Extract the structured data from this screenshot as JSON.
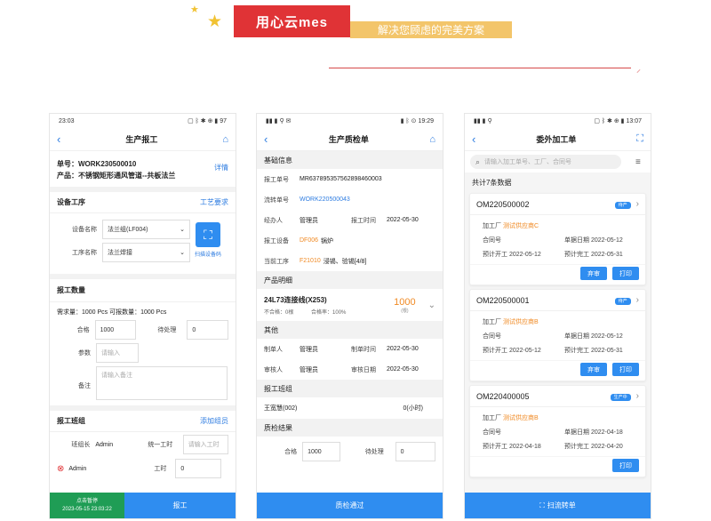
{
  "header": {
    "brand": "用心云mes",
    "tagline": "解决您顾虑的完美方案"
  },
  "phone1": {
    "time": "23:03",
    "status_icons": "▢ ᛒ ✱ ⊕ ▮ 97",
    "title": "生产报工",
    "order_label": "单号：",
    "order_no": "WORK230500010",
    "product_label": "产品：",
    "product": "不锈钢矩形通风管道--共板法兰",
    "detail_link": "详情",
    "equip_section": "设备工序",
    "process_req": "工艺要求",
    "equip_name_label": "设备名称",
    "equip_name_value": "法兰组(LF004)",
    "process_name_label": "工序名称",
    "process_name_value": "法兰焊接",
    "scan_label": "扫描设备码",
    "qty_section": "报工数量",
    "demand_text": "需求量：1000 Pcs 可报数量：1000 Pcs",
    "ok_label": "合格",
    "ok_value": "1000",
    "pending_label": "待处理",
    "pending_value": "0",
    "param_label": "参数",
    "param_ph": "请输入",
    "remark_label": "备注",
    "remark_ph": "请输入备注",
    "team_section": "报工班组",
    "add_member": "添加组员",
    "leader_label": "班组长",
    "leader_value": "Admin",
    "unified_hours_label": "统一工时",
    "unified_hours_ph": "请输入工时",
    "member_name": "Admin",
    "hours_label": "工时",
    "hours_value": "0",
    "pause_label": "点击暂停",
    "pause_time": "2023-05-15 23:03:22",
    "submit_label": "报工"
  },
  "phone2": {
    "time": "19:29",
    "status_icons": "▮ ᛒ ⊙",
    "signal": "▮▮ ▮ ⚲ ✉",
    "title": "生产质检单",
    "basic_section": "基础信息",
    "report_no_label": "报工单号",
    "report_no": "MR637895357562898460003",
    "flow_no_label": "流转单号",
    "flow_no": "WORK220500043",
    "handler_label": "经办人",
    "handler_value": "管理员",
    "report_time_label": "报工时间",
    "report_time_value": "2022-05-30",
    "equip_label": "报工设备",
    "equip_code": "DF006",
    "equip_name": "锅炉",
    "process_label": "当前工序",
    "process_code": "F21010",
    "process_name": "浸锡、验锡[4/8]",
    "product_section": "产品明细",
    "product_name": "24L73连接线(X253)",
    "bad_text": "不合格：0根",
    "ok_rate_text": "合格率：100%",
    "product_qty": "1000",
    "product_unit": "(根)",
    "other_section": "其他",
    "maker_label": "制单人",
    "maker_value": "管理员",
    "make_time_label": "制单时间",
    "make_time_value": "2022-05-30",
    "auditor_label": "审核人",
    "auditor_value": "管理员",
    "audit_date_label": "审核日期",
    "audit_date_value": "2022-05-30",
    "team_section": "报工班组",
    "team_name": "王宽慧(002)",
    "team_hours": "0(小时)",
    "result_section": "质检结果",
    "ok_label": "合格",
    "ok_value": "1000",
    "pending_label": "待处理",
    "pending_value": "0",
    "submit_label": "质检通过"
  },
  "phone3": {
    "time": "13:07",
    "signal": "▮▮ ▮ ⚲",
    "status_icons": "▢ ᛒ ✱ ⊕ ▮",
    "title": "委外加工单",
    "search_ph": "请输入加工单号、工厂、合同号",
    "total_text": "共计7条数据",
    "factory_label": "加工厂",
    "contract_label": "合同号",
    "doc_date_label": "单据日期",
    "plan_start_label": "预计开工",
    "plan_end_label": "预计完工",
    "discard_label": "弃审",
    "print_label": "打印",
    "scan_label": "扫流转单",
    "cards": [
      {
        "no": "OM220500002",
        "badge": "待产",
        "factory": "测试供应商C",
        "doc_date": "2022-05-12",
        "start": "2022-05-12",
        "end": "2022-05-31"
      },
      {
        "no": "OM220500001",
        "badge": "待产",
        "factory": "测试供应商B",
        "doc_date": "2022-05-12",
        "start": "2022-05-12",
        "end": "2022-05-31"
      },
      {
        "no": "OM220400005",
        "badge": "生产中",
        "factory": "测试供应商B",
        "doc_date": "2022-04-18",
        "start": "2022-04-18",
        "end": "2022-04-20"
      }
    ]
  }
}
